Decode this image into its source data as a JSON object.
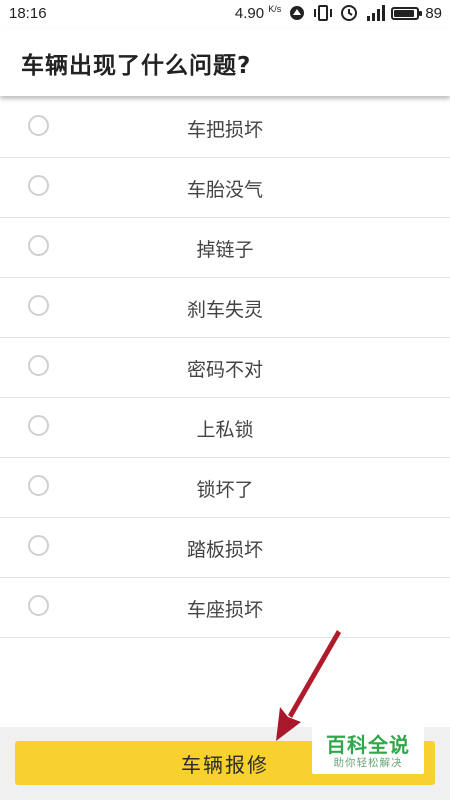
{
  "status_bar": {
    "time": "18:16",
    "speed": "4.90",
    "speed_unit": "K/s",
    "battery_level": "89",
    "icons": [
      "hotspot-icon",
      "vibrate-icon",
      "alarm-icon",
      "signal-icon",
      "battery-icon"
    ]
  },
  "header": {
    "title": "车辆出现了什么问题?"
  },
  "options": [
    {
      "label": "车把损坏"
    },
    {
      "label": "车胎没气"
    },
    {
      "label": "掉链子"
    },
    {
      "label": "刹车失灵"
    },
    {
      "label": "密码不对"
    },
    {
      "label": "上私锁"
    },
    {
      "label": "锁坏了"
    },
    {
      "label": "踏板损坏"
    },
    {
      "label": "车座损坏"
    }
  ],
  "repair_button": {
    "label": "车辆报修"
  },
  "watermark": {
    "main": "百科全说",
    "sub": "助你轻松解决"
  },
  "colors": {
    "button": "#f8d12f",
    "arrow": "#b41a2a",
    "watermark_green": "#2fa84a"
  }
}
